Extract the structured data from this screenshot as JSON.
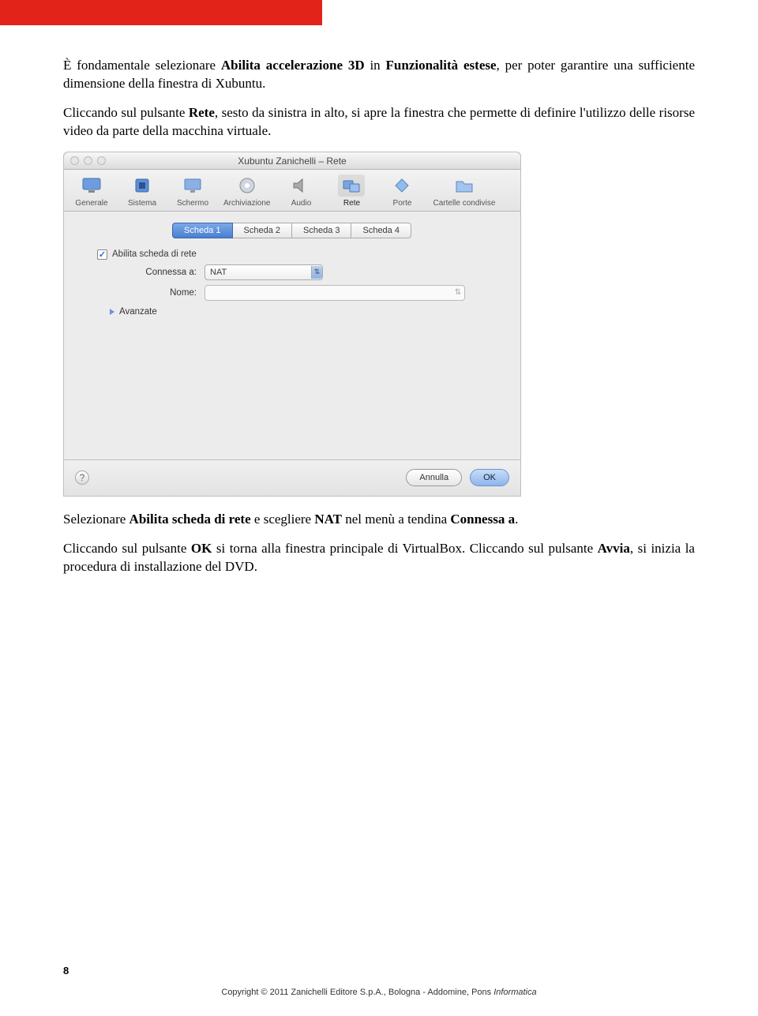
{
  "para1_a": "È fondamentale selezionare ",
  "para1_b": "Abilita accelerazione 3D",
  "para1_c": " in ",
  "para1_d": "Funzionalità estese",
  "para1_e": ", per poter garantire una sufficiente dimensione della finestra di Xubuntu.",
  "para2_a": "Cliccando sul pulsante ",
  "para2_b": "Rete",
  "para2_c": ", sesto da sinistra in alto, si apre la finestra che permette di definire l'utilizzo delle risorse video da parte della macchina virtuale.",
  "window": {
    "title": "Xubuntu Zanichelli – Rete",
    "toolbar": [
      {
        "label": "Generale",
        "icon": "monitor"
      },
      {
        "label": "Sistema",
        "icon": "chip"
      },
      {
        "label": "Schermo",
        "icon": "display"
      },
      {
        "label": "Archiviazione",
        "icon": "disk"
      },
      {
        "label": "Audio",
        "icon": "speaker"
      },
      {
        "label": "Rete",
        "icon": "cards",
        "selected": true
      },
      {
        "label": "Porte",
        "icon": "diamond"
      },
      {
        "label": "Cartelle condivise",
        "icon": "folder"
      }
    ],
    "tabs": [
      "Scheda 1",
      "Scheda 2",
      "Scheda 3",
      "Scheda 4"
    ],
    "active_tab": 0,
    "checkbox_label": "Abilita scheda di rete",
    "connessa_label": "Connessa a:",
    "connessa_value": "NAT",
    "nome_label": "Nome:",
    "nome_value": "",
    "avanzate_label": "Avanzate",
    "cancel": "Annulla",
    "ok": "OK"
  },
  "para3_a": "Selezionare ",
  "para3_b": "Abilita scheda di rete",
  "para3_c": " e scegliere ",
  "para3_d": "NAT",
  "para3_e": " nel menù a tendina ",
  "para3_f": "Connessa a",
  "para3_g": ".",
  "para4_a": "Cliccando sul pulsante ",
  "para4_b": "OK",
  "para4_c": " si torna alla finestra principale di VirtualBox. Cliccando sul pulsante ",
  "para4_d": "Avvia",
  "para4_e": ", si inizia la procedura di installazione del DVD.",
  "page_number": "8",
  "footer_a": "Copyright © 2011 Zanichelli Editore S.p.A., Bologna - Addomine, Pons ",
  "footer_b": "Informatica"
}
